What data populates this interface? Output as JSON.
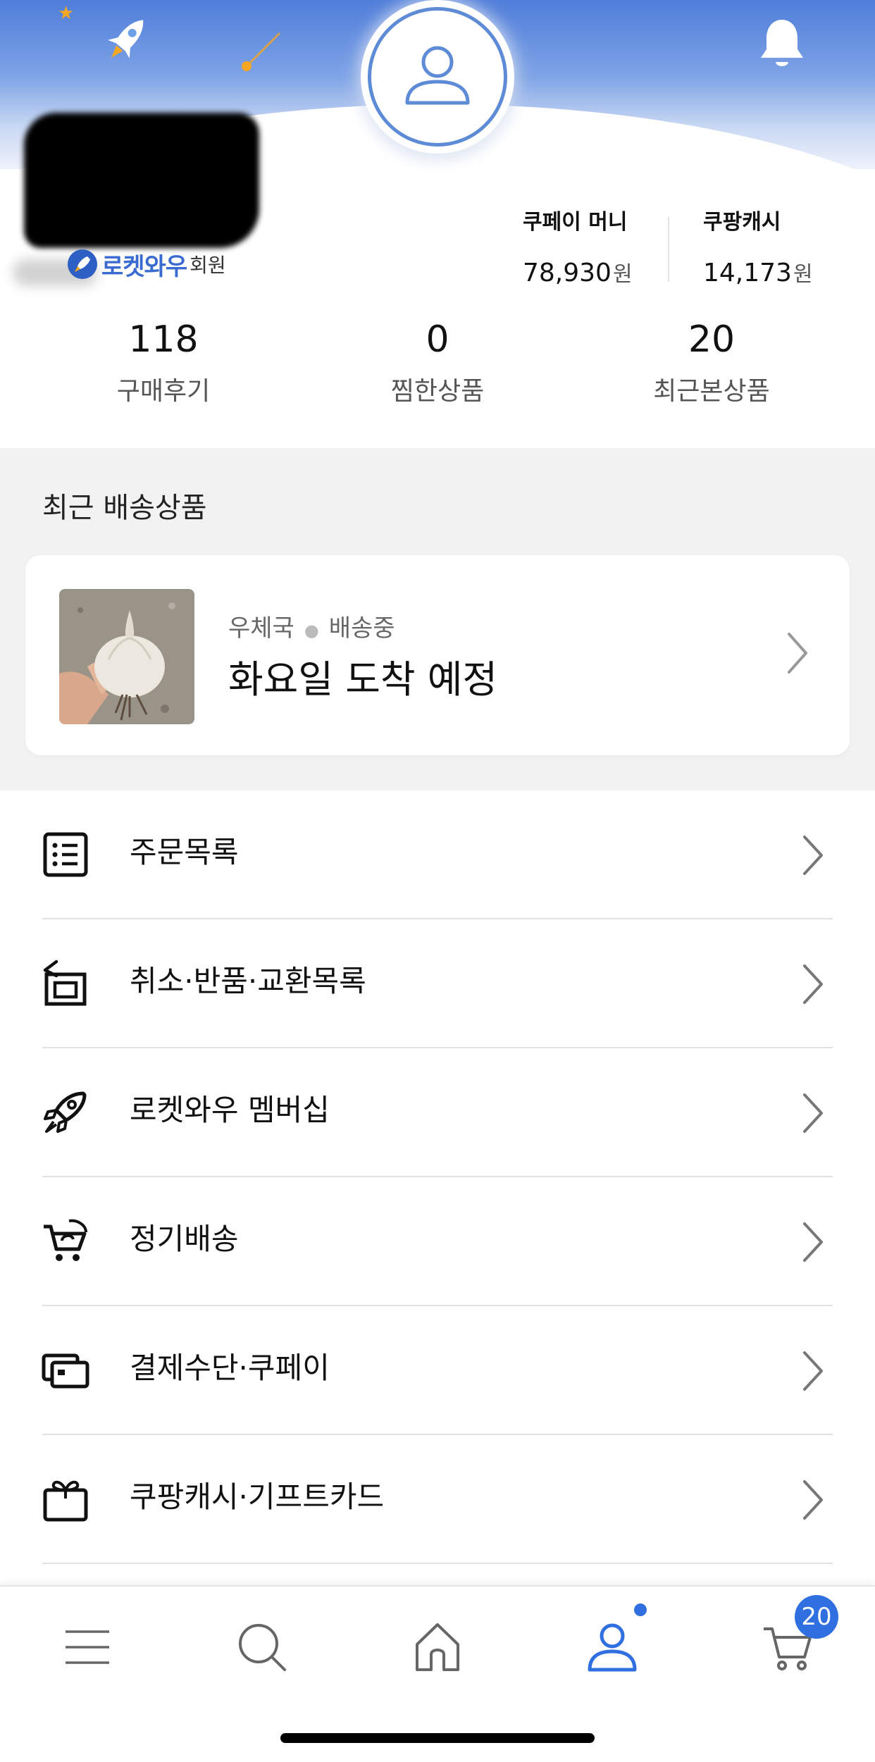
{
  "header": {
    "membership_badge": "로켓와우",
    "membership_suffix": "회원"
  },
  "balances": [
    {
      "label": "쿠페이 머니",
      "value": "78,930",
      "unit": "원"
    },
    {
      "label": "쿠팡캐시",
      "value": "14,173",
      "unit": "원"
    }
  ],
  "stats": [
    {
      "value": "118",
      "label": "구매후기"
    },
    {
      "value": "0",
      "label": "찜한상품"
    },
    {
      "value": "20",
      "label": "최근본상품"
    }
  ],
  "recent_delivery": {
    "section_title": "최근 배송상품",
    "carrier": "우체국",
    "status": "배송중",
    "eta": "화요일 도착 예정"
  },
  "menu": [
    {
      "label": "주문목록",
      "icon": "order-list-icon"
    },
    {
      "label": "취소·반품·교환목록",
      "icon": "return-icon"
    },
    {
      "label": "로켓와우 멤버십",
      "icon": "rocket-icon"
    },
    {
      "label": "정기배송",
      "icon": "subscription-cart-icon"
    },
    {
      "label": "결제수단·쿠페이",
      "icon": "payment-card-icon"
    },
    {
      "label": "쿠팡캐시·기프트카드",
      "icon": "gift-card-icon"
    }
  ],
  "bottom_nav": {
    "items": [
      "menu-icon",
      "search-icon",
      "home-icon",
      "my-page-icon",
      "cart-icon"
    ],
    "cart_count": "20",
    "active": "my-page"
  },
  "colors": {
    "accent": "#2f6fe0",
    "header_top": "#4f7dd9",
    "divider": "#e2e2e2",
    "section_bg": "#f2f2f2"
  }
}
